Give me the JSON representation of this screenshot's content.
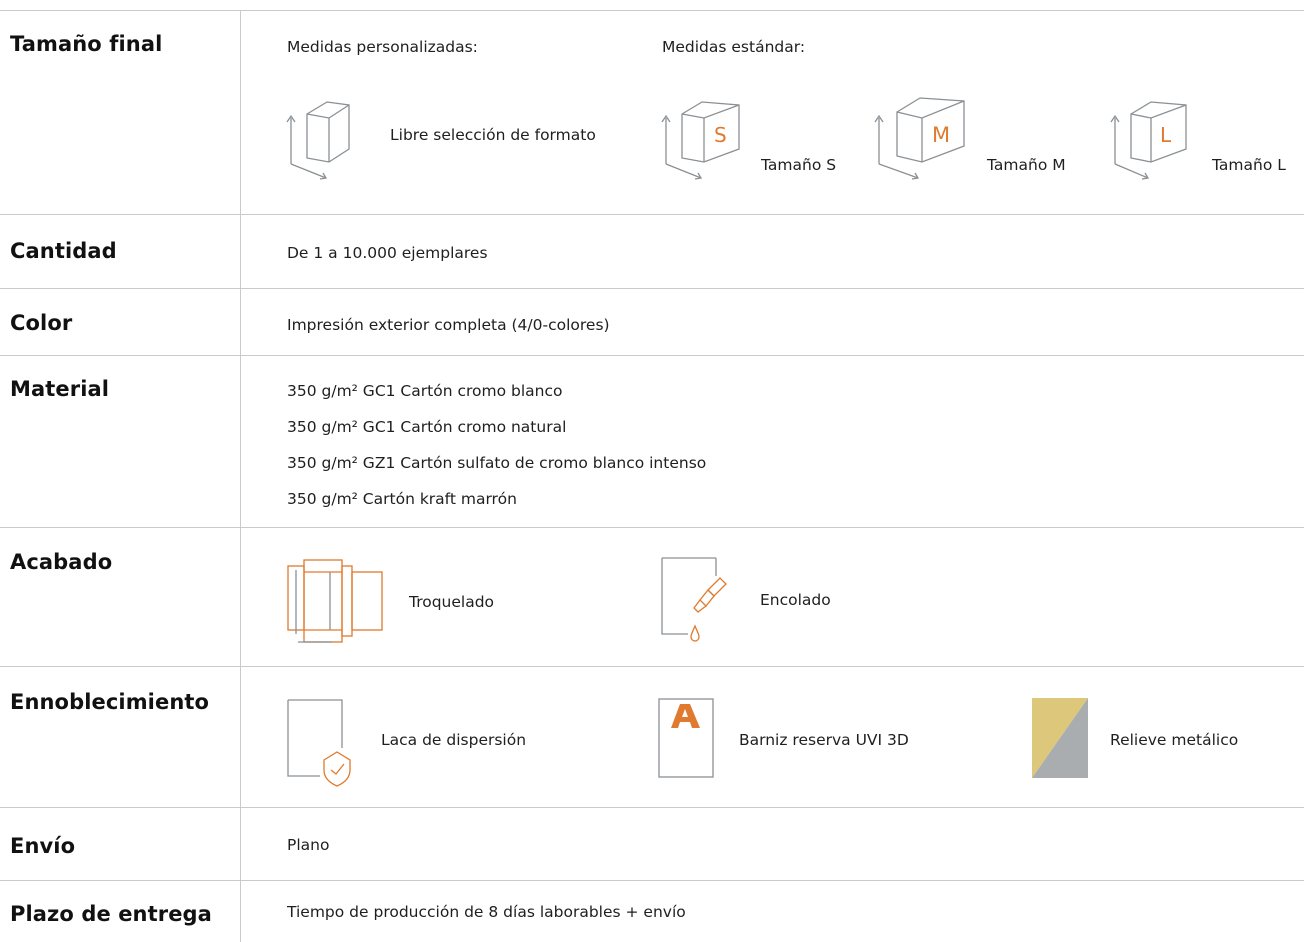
{
  "rows": {
    "tamano": {
      "label": "Tamaño final",
      "custom_heading": "Medidas personalizadas:",
      "custom_option": "Libre selección de formato",
      "standard_heading": "Medidas estándar:",
      "sizes": [
        {
          "letter": "S",
          "label": "Tamaño S"
        },
        {
          "letter": "M",
          "label": "Tamaño M"
        },
        {
          "letter": "L",
          "label": "Tamaño L"
        }
      ]
    },
    "cantidad": {
      "label": "Cantidad",
      "value": "De 1 a 10.000 ejemplares"
    },
    "color": {
      "label": "Color",
      "value": "Impresión exterior completa (4/0-colores)"
    },
    "material": {
      "label": "Material",
      "options": [
        "350 g/m² GC1 Cartón cromo blanco",
        "350 g/m² GC1 Cartón cromo natural",
        "350 g/m² GZ1 Cartón sulfato de cromo blanco intenso",
        "350 g/m² Cartón kraft marrón"
      ]
    },
    "acabado": {
      "label": "Acabado",
      "options": [
        "Troquelado",
        "Encolado"
      ]
    },
    "ennoblecimiento": {
      "label": "Ennoblecimiento",
      "options": [
        "Laca de dispersión",
        "Barniz reserva UVI 3D",
        "Relieve metálico"
      ]
    },
    "envio": {
      "label": "Envío",
      "value": "Plano"
    },
    "plazo": {
      "label": "Plazo de entrega",
      "value": "Tiempo de producción de 8 días laborables + envío"
    }
  },
  "colors": {
    "accent": "#e07a2e",
    "line": "#8a9094",
    "divider": "#c8cacc",
    "metal_gold": "#dcc77a",
    "metal_silver": "#a9adaf"
  },
  "icons": [
    "box-dimension-icon",
    "die-cut-icon",
    "glue-icon",
    "dispersion-varnish-icon",
    "uv-varnish-icon",
    "metallic-foil-icon"
  ]
}
